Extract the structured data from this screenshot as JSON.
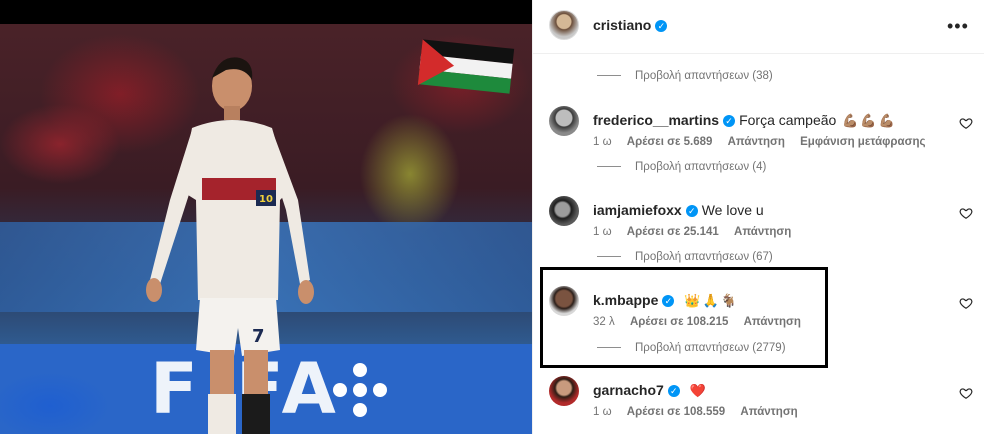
{
  "post": {
    "author": "cristiano"
  },
  "comments": [
    {
      "username": "frederico__martins",
      "text": "Força campeão",
      "emoji": [
        "💪🏽",
        "💪🏽",
        "💪🏽"
      ],
      "time": "1 ω",
      "likes": "Αρέσει σε 5.689",
      "reply": "Απάντηση",
      "translate": "Εμφάνιση μετάφρασης"
    },
    {
      "username": "iamjamiefoxx",
      "text": "We love u",
      "time": "1 ω",
      "likes": "Αρέσει σε 25.141",
      "reply": "Απάντηση"
    },
    {
      "username": "k.mbappe",
      "text": "",
      "emoji": [
        "👑",
        "🙏",
        "🐐"
      ],
      "time": "32 λ",
      "likes": "Αρέσει σε 108.215",
      "reply": "Απάντηση"
    },
    {
      "username": "garnacho7",
      "text": "",
      "emoji": [
        "❤️"
      ],
      "time": "1 ω",
      "likes": "Αρέσει σε 108.559",
      "reply": "Απάντηση"
    }
  ],
  "replies": [
    "Προβολή απαντήσεων (38)",
    "Προβολή απαντήσεων (4)",
    "Προβολή απαντήσεων (67)",
    "Προβολή απαντήσεων (2779)"
  ],
  "photo": {
    "fifa_text": "FIFA",
    "jersey_number": "7",
    "armband": "10"
  },
  "colors": {
    "verified": "#0095f6",
    "meta_text": "#737373",
    "highlight_border": "#000000"
  },
  "icons": {
    "more": "more-options-icon",
    "heart": "heart-outline-icon",
    "verified": "verified-badge-icon"
  }
}
